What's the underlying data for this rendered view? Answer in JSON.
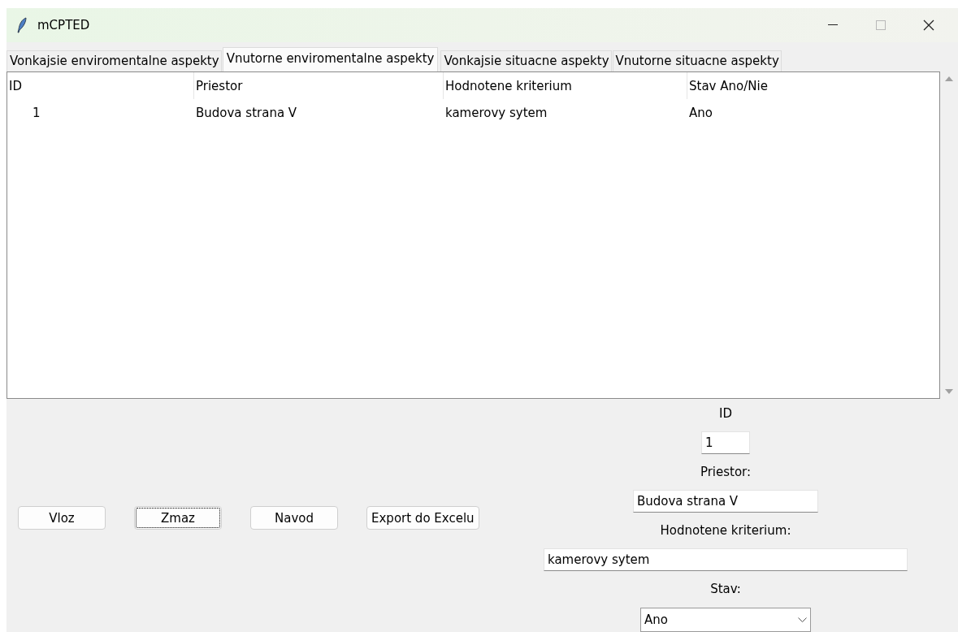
{
  "window": {
    "title": "mCPTED"
  },
  "tabs": [
    {
      "label": "Vonkajsie enviromentalne aspekty",
      "selected": false
    },
    {
      "label": "Vnutorne enviromentalne aspekty",
      "selected": true
    },
    {
      "label": "Vonkajsie situacne aspekty",
      "selected": false
    },
    {
      "label": "Vnutorne situacne aspekty",
      "selected": false
    }
  ],
  "table": {
    "columns": [
      "ID",
      "Priestor",
      "Hodnotene kriterium",
      "Stav Ano/Nie"
    ],
    "rows": [
      [
        "1",
        "Budova strana V",
        "kamerovy sytem",
        "Ano"
      ]
    ]
  },
  "buttons": [
    {
      "label": "Vloz",
      "focused": false
    },
    {
      "label": "Zmaz",
      "focused": true
    },
    {
      "label": "Navod",
      "focused": false
    },
    {
      "label": "Export do Excelu",
      "focused": false
    }
  ],
  "form": [
    {
      "kind": "entry",
      "label": "ID",
      "value": "1"
    },
    {
      "kind": "entry",
      "label": "Priestor:",
      "value": "Budova strana V"
    },
    {
      "kind": "entry",
      "label": "Hodnotene kriterium:",
      "value": "kamerovy sytem"
    },
    {
      "kind": "combo",
      "label": "Stav:",
      "value": "Ano"
    }
  ]
}
